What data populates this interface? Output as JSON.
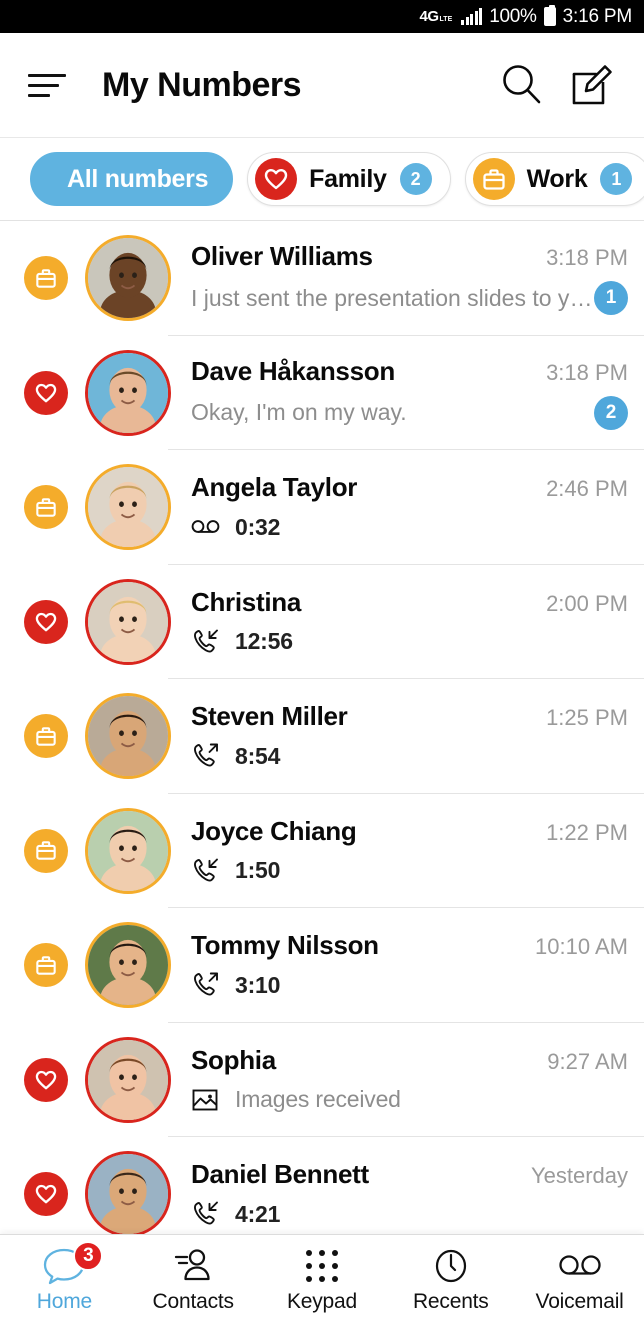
{
  "status_bar": {
    "network": "4G",
    "network_sub": "LTE",
    "battery_percent": "100%",
    "time": "3:16 PM"
  },
  "header": {
    "menu_icon": "hamburger-menu-icon",
    "title": "My Numbers",
    "search_icon": "search-icon",
    "compose_icon": "compose-icon"
  },
  "filters": {
    "chips": [
      {
        "label": "All numbers",
        "icon": null,
        "count": null,
        "active": true
      },
      {
        "label": "Family",
        "icon": "heart-icon",
        "count": "2",
        "active": false
      },
      {
        "label": "Work",
        "icon": "briefcase-icon",
        "count": "1",
        "active": false
      }
    ]
  },
  "colors": {
    "accent_blue": "#4FA7DB",
    "chip_blue": "#5FB3E0",
    "family_red": "#D9251D",
    "work_orange": "#F4AC2B",
    "badge_red": "#E02020",
    "muted_text": "#8d8d8d"
  },
  "conversations": [
    {
      "name": "Oliver Williams",
      "time": "3:18 PM",
      "tag": "work",
      "tag_icon": "briefcase-icon",
      "type": "message",
      "preview": "I just sent the presentation slides to yo…",
      "unread": "1"
    },
    {
      "name": "Dave Håkansson",
      "time": "3:18 PM",
      "tag": "family",
      "tag_icon": "heart-icon",
      "type": "message",
      "preview": "Okay, I'm on my way.",
      "unread": "2"
    },
    {
      "name": "Angela Taylor",
      "time": "2:46 PM",
      "tag": "work",
      "tag_icon": "briefcase-icon",
      "type": "voicemail",
      "sub_icon": "voicemail-icon",
      "sub_text": "0:32",
      "unread": null
    },
    {
      "name": "Christina",
      "time": "2:00 PM",
      "tag": "family",
      "tag_icon": "heart-icon",
      "type": "incoming_call",
      "sub_icon": "incoming-call-icon",
      "sub_text": "12:56",
      "unread": null
    },
    {
      "name": "Steven Miller",
      "time": "1:25 PM",
      "tag": "work",
      "tag_icon": "briefcase-icon",
      "type": "outgoing_call",
      "sub_icon": "outgoing-call-icon",
      "sub_text": "8:54",
      "unread": null
    },
    {
      "name": "Joyce Chiang",
      "time": "1:22 PM",
      "tag": "work",
      "tag_icon": "briefcase-icon",
      "type": "incoming_call",
      "sub_icon": "incoming-call-icon",
      "sub_text": "1:50",
      "unread": null
    },
    {
      "name": "Tommy Nilsson",
      "time": "10:10 AM",
      "tag": "work",
      "tag_icon": "briefcase-icon",
      "type": "outgoing_call",
      "sub_icon": "outgoing-call-icon",
      "sub_text": "3:10",
      "unread": null
    },
    {
      "name": "Sophia",
      "time": "9:27 AM",
      "tag": "family",
      "tag_icon": "heart-icon",
      "type": "images",
      "sub_icon": "image-icon",
      "sub_text": "Images received",
      "unread": null
    },
    {
      "name": "Daniel Bennett",
      "time": "Yesterday",
      "tag": "family",
      "tag_icon": "heart-icon",
      "type": "incoming_call",
      "sub_icon": "incoming-call-icon",
      "sub_text": "4:21",
      "unread": null
    }
  ],
  "bottom_nav": {
    "items": [
      {
        "label": "Home",
        "icon": "chat-bubble-icon",
        "badge": "3",
        "active": true
      },
      {
        "label": "Contacts",
        "icon": "contacts-person-icon",
        "badge": null,
        "active": false
      },
      {
        "label": "Keypad",
        "icon": "keypad-dots-icon",
        "badge": null,
        "active": false
      },
      {
        "label": "Recents",
        "icon": "clock-icon",
        "badge": null,
        "active": false
      },
      {
        "label": "Voicemail",
        "icon": "voicemail-icon",
        "badge": null,
        "active": false
      }
    ]
  }
}
